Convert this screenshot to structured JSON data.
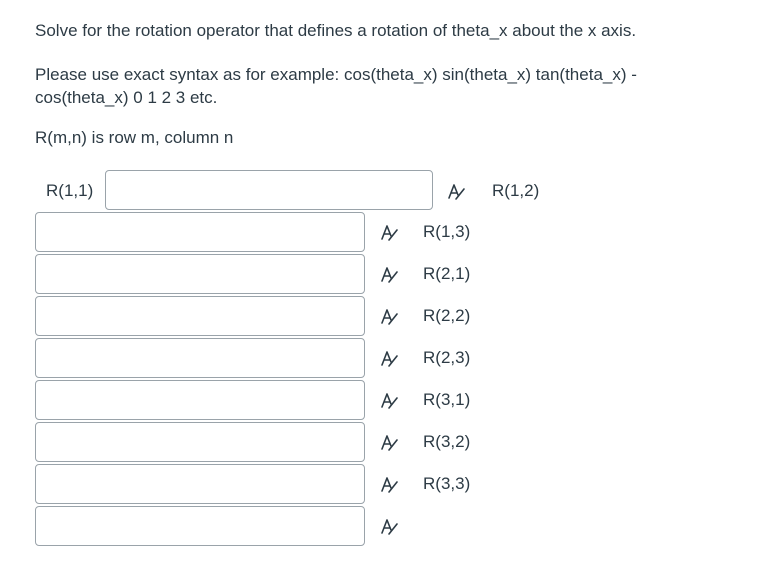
{
  "question": {
    "line1": "Solve for the rotation operator that defines a rotation of theta_x about the x axis.",
    "line2": "Please use exact syntax as for example: cos(theta_x) sin(theta_x) tan(theta_x) -",
    "line2b": "cos(theta_x) 0 1 2 3 etc.",
    "line3": "R(m,n) is row m, column n"
  },
  "inputs": [
    {
      "label": "R(1,1)",
      "value": ""
    },
    {
      "label": "R(1,2)",
      "value": ""
    },
    {
      "label": "R(1,3)",
      "value": ""
    },
    {
      "label": "R(2,1)",
      "value": ""
    },
    {
      "label": "R(2,2)",
      "value": ""
    },
    {
      "label": "R(2,3)",
      "value": ""
    },
    {
      "label": "R(3,1)",
      "value": ""
    },
    {
      "label": "R(3,2)",
      "value": ""
    },
    {
      "label": "R(3,3)",
      "value": ""
    }
  ],
  "icons": {
    "equation_editor": "equation-editor-icon"
  },
  "colors": {
    "text": "#2d3b45",
    "input_border": "#9aa3aa"
  }
}
